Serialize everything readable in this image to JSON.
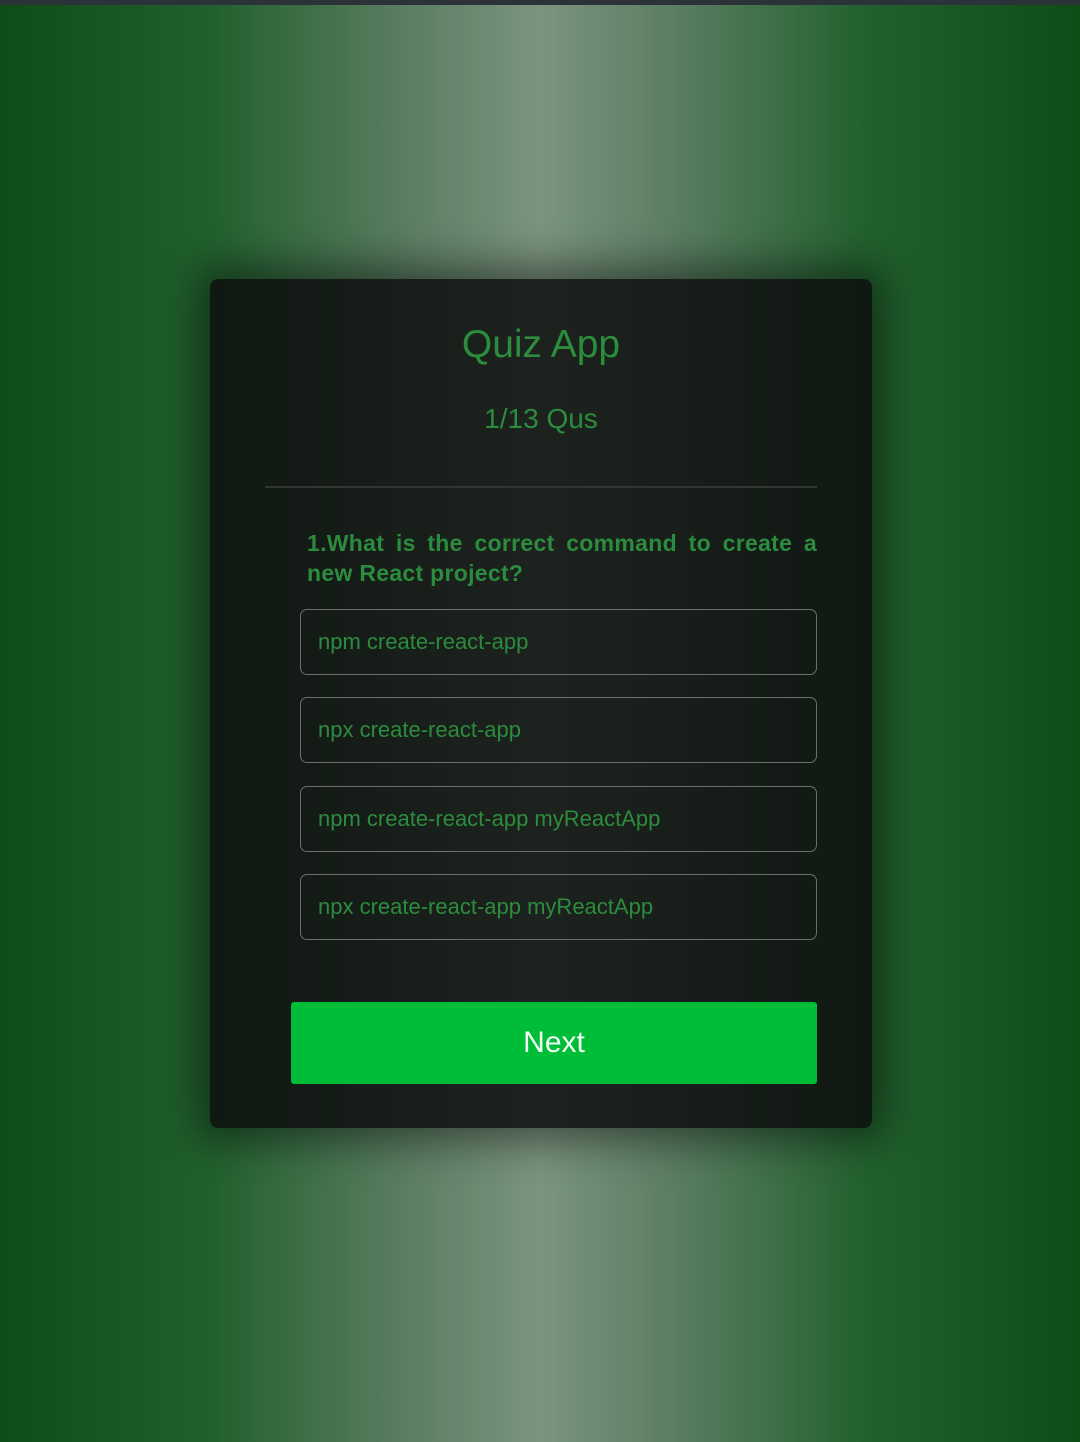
{
  "app": {
    "title": "Quiz App",
    "counter": "1/13 Qus"
  },
  "question": {
    "text": "1.What is the correct command to create a new React project?",
    "options": [
      "npm create-react-app",
      "npx create-react-app",
      "npm create-react-app myReactApp",
      "npx create-react-app myReactApp"
    ]
  },
  "actions": {
    "next_label": "Next"
  },
  "colors": {
    "accent_text": "#2c8c3d",
    "button_bg": "#00bd38",
    "card_bg": "#1a1f1c"
  }
}
